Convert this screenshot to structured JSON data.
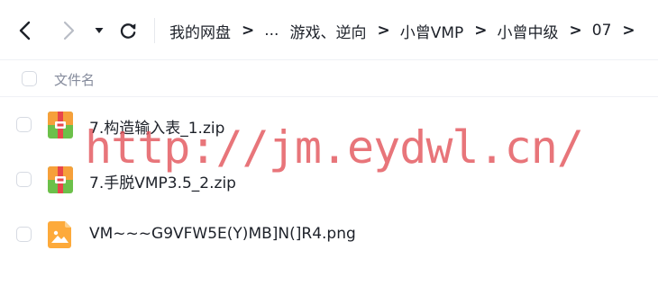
{
  "nav": {
    "back_icon": "chevron-left-icon",
    "forward_icon": "chevron-right-icon",
    "dropdown_icon": "caret-down-icon",
    "refresh_icon": "refresh-icon"
  },
  "breadcrumb": {
    "items": [
      "我的网盘",
      "...",
      "游戏、逆向",
      "小曾VMP",
      "小曾中级",
      "07"
    ],
    "separator": ">"
  },
  "list_header": {
    "name_label": "文件名"
  },
  "files": [
    {
      "name": "7.构造输入表_1.zip",
      "icon": "zip-archive-icon"
    },
    {
      "name": "7.手脱VMP3.5_2.zip",
      "icon": "zip-archive-icon"
    },
    {
      "name": "VM~~~G9VFW5E(Y)MB]N(]R4.png",
      "icon": "image-file-icon"
    }
  ],
  "watermark": {
    "text": "http://jm.eydwl.cn/"
  },
  "colors": {
    "text": "#1d2129",
    "muted": "#858b9c",
    "watermark": "#e24e54",
    "zip_orange": "#f6a03a",
    "zip_green": "#6cc04a",
    "image_orange": "#fdaa3b"
  }
}
